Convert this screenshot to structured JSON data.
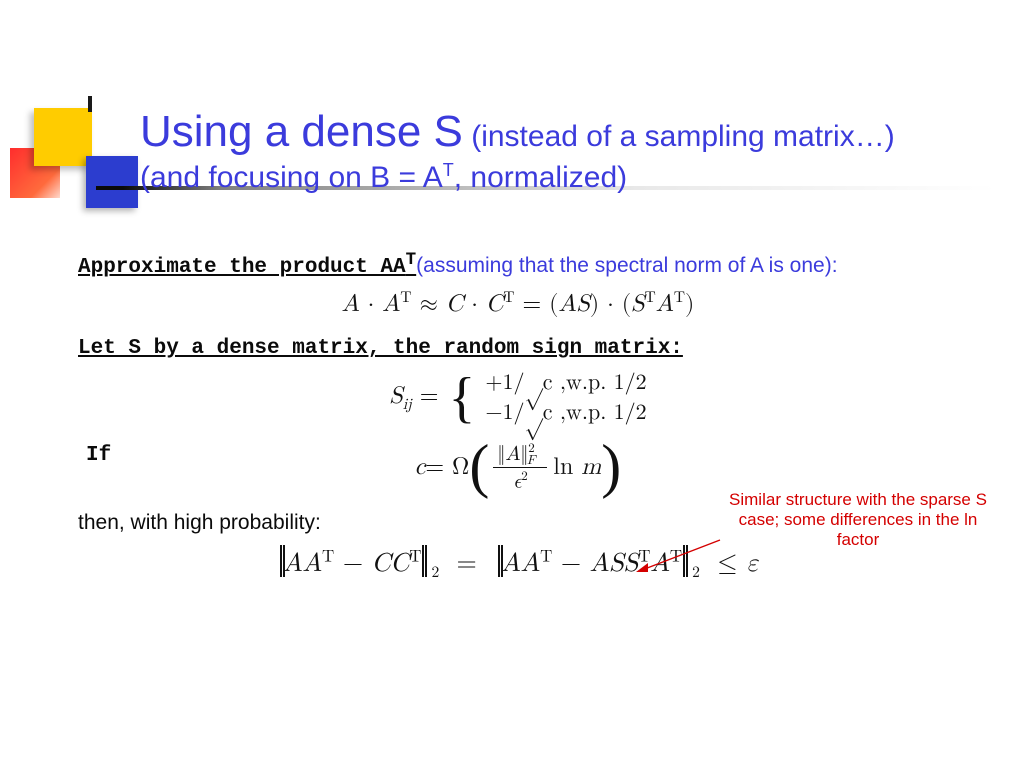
{
  "title": {
    "main": "Using a dense S",
    "sub1": "(instead of a sampling matrix…)",
    "sub2_a": "(and focusing on B = A",
    "sub2_sup": "T",
    "sub2_b": ", normalized)"
  },
  "line1": {
    "heading_a": "Approximate the product AA",
    "heading_sup": "T",
    "tail": "(assuming that the spectral norm of A is one)",
    "colon": ":"
  },
  "eq1": "A · Aᵀ ≈ C · Cᵀ = (AS) · (Sᵀ Aᵀ)",
  "line2": "Let S by a dense matrix, the random sign matrix:",
  "eq2": {
    "lhs": "S",
    "sub": "ij",
    "eq": " = ",
    "case1": "+1/√c   ,w.p. 1/2",
    "case2": "−1/√c   ,w.p. 1/2"
  },
  "line3": "If",
  "eq3": {
    "lhs": "c = Ω",
    "frac_num": "‖A‖²_F",
    "frac_den": "ϵ²",
    "tail": " ln m"
  },
  "line4": "then, with high probability:",
  "eq4": {
    "left": "AAᵀ − CCᵀ",
    "mid": " = ",
    "right": "AAᵀ − ASSᵀAᵀ",
    "tail": " ≤ ε",
    "sub": "2"
  },
  "annotation": "Similar structure with the sparse S case; some differences in the ln factor"
}
